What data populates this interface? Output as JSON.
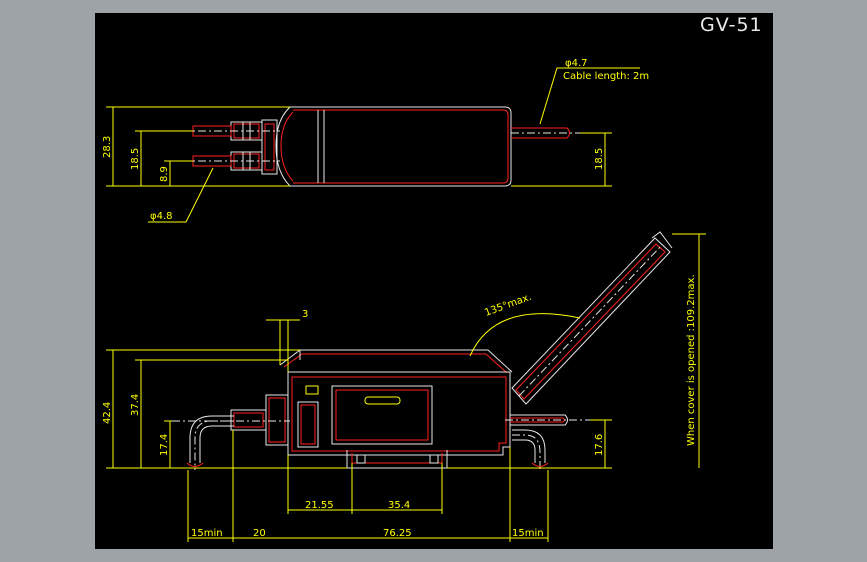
{
  "title": "GV-51",
  "top_view": {
    "cable_label": "φ4.7",
    "cable_length": "Cable length: 2m",
    "fiber_dia": "φ4.8",
    "dims": {
      "height_total": "28.3",
      "height_left": "18.5",
      "height_right": "18.5",
      "small": "8.9"
    }
  },
  "side_view": {
    "gap": "3",
    "angle": "135°max.",
    "open_note": "When cover is opened :109.2max.",
    "dims": {
      "h1": "42.4",
      "h2": "37.4",
      "h3": "17.4",
      "h4": "17.6",
      "w1": "21.55",
      "w2": "35.4",
      "b1": "15min",
      "b2": "20",
      "b3": "76.25",
      "b4": "15min"
    }
  },
  "colors": {
    "background": "#9ea3a8",
    "sheet": "#000000",
    "dimension": "#ffff00",
    "outline": "#e8e8e8",
    "hidden": "#ff2020"
  }
}
